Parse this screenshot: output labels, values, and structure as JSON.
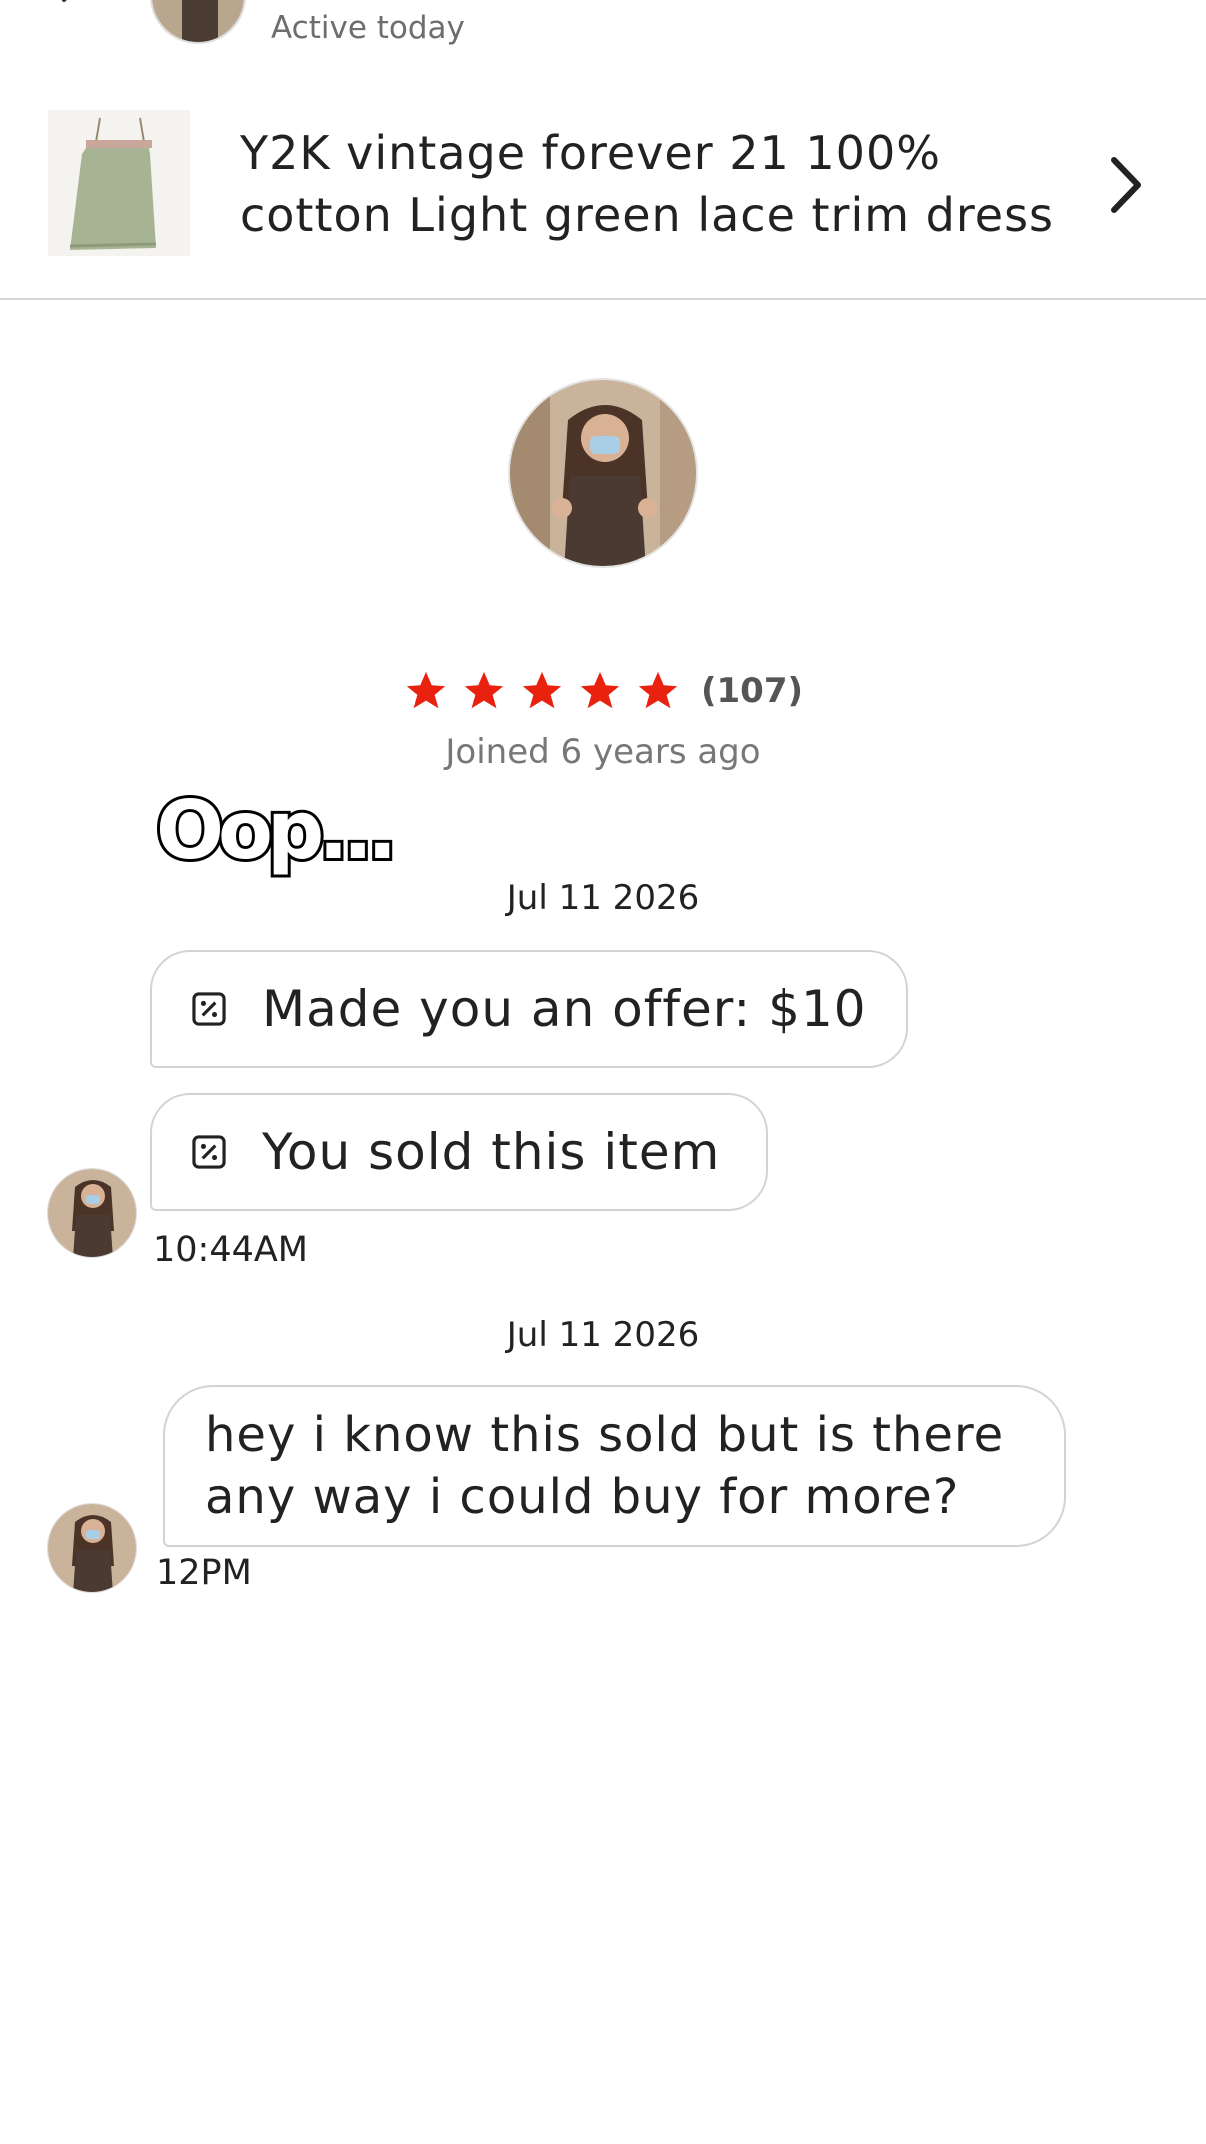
{
  "header": {
    "status": "Active today",
    "icons": {
      "back": "chevron-left-icon",
      "more": "more-vertical-icon"
    }
  },
  "listing": {
    "title": "Y2K vintage forever 21 100% cotton Light green lace trim dress",
    "thumb_color": "#a7b494"
  },
  "profile": {
    "rating_count": "(107)",
    "stars": 5,
    "star_color": "#e8220f",
    "joined": "Joined 6 years ago"
  },
  "sticker": {
    "text": "Oop..."
  },
  "messages": {
    "date_1": "Jul 11 2026",
    "offer_text": "Made you an offer: $10",
    "sold_text": "You sold this item",
    "time_1": "10:44AM",
    "date_2": "Jul 11 2026",
    "user_message": "hey i know this sold but is there any way i could buy for more?",
    "time_2": "12PM"
  }
}
